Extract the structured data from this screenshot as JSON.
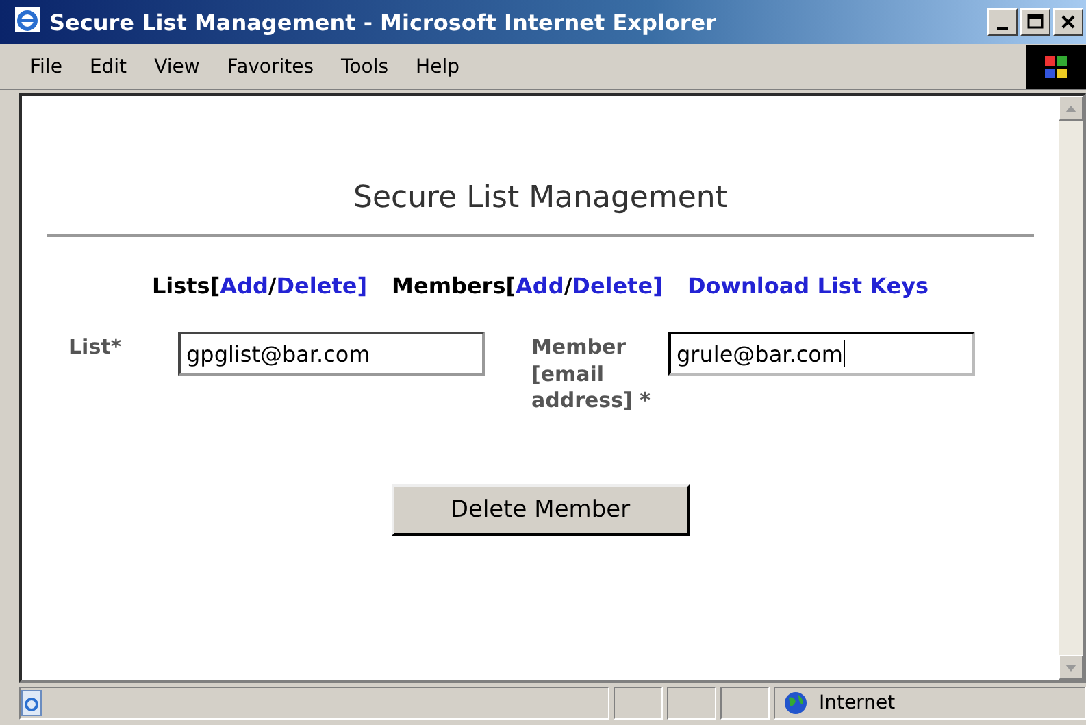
{
  "window": {
    "title": "Secure List Management - Microsoft Internet Explorer"
  },
  "menu": [
    "File",
    "Edit",
    "View",
    "Favorites",
    "Tools",
    "Help"
  ],
  "page": {
    "heading": "Secure List Management",
    "nav": [
      {
        "kind": "group",
        "label": "Lists[",
        "links": [
          "Add",
          "Delete"
        ],
        "separator": "/",
        "close": "]"
      },
      {
        "kind": "group",
        "label": "Members[",
        "links": [
          "Add",
          "Delete"
        ],
        "separator": "/",
        "close": "]"
      },
      {
        "kind": "link",
        "text": "Download List Keys"
      }
    ],
    "fields": [
      {
        "label": "List*",
        "value": "gpglist@bar.com",
        "focused": false
      },
      {
        "label": "Member [email address] *",
        "value": "grule@bar.com",
        "focused": true
      }
    ],
    "button": "Delete Member"
  },
  "status_bar": {
    "zone": "Internet"
  }
}
